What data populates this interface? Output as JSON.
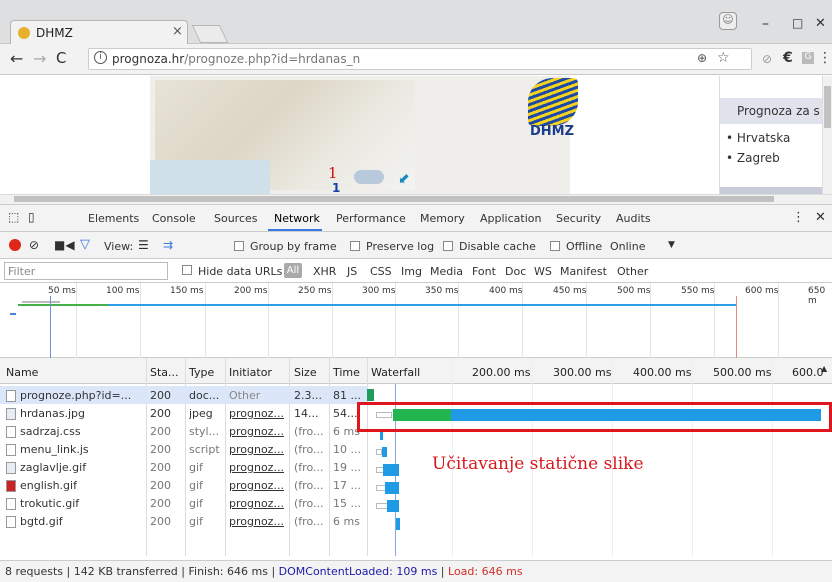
{
  "browser": {
    "tab_title": "DHMZ",
    "tab_close": "×",
    "url_host": "prognoza.hr",
    "url_path": "/prognoze.php?id=hrdanas_n",
    "controls": {
      "minimize": "–",
      "maximize": "□",
      "close": "✕",
      "back": "←",
      "forward": "→",
      "reload": "C",
      "zoom": "⊕",
      "star": "☆",
      "menu": "⋮"
    }
  },
  "page": {
    "logo_text": "DHMZ",
    "map_number_red": "1",
    "map_number_blue": "1",
    "side_heading": "Prognoza za s",
    "side_links": [
      "Hrvatska",
      "Zagreb"
    ]
  },
  "devtools": {
    "tabs": [
      "Elements",
      "Console",
      "Sources",
      "Network",
      "Performance",
      "Memory",
      "Application",
      "Security",
      "Audits"
    ],
    "active_tab": "Network",
    "toolbar": {
      "view_label": "View:",
      "group_by_frame": "Group by frame",
      "preserve_log": "Preserve log",
      "disable_cache": "Disable cache",
      "offline": "Offline",
      "throttle": "Online"
    },
    "filter": {
      "placeholder": "Filter",
      "hide_data_urls": "Hide data URLs",
      "types": [
        "All",
        "XHR",
        "JS",
        "CSS",
        "Img",
        "Media",
        "Font",
        "Doc",
        "WS",
        "Manifest",
        "Other"
      ]
    },
    "overview_ticks": [
      "50 ms",
      "100 ms",
      "150 ms",
      "200 ms",
      "250 ms",
      "300 ms",
      "350 ms",
      "400 ms",
      "450 ms",
      "500 ms",
      "550 ms",
      "600 ms",
      "650 m"
    ],
    "columns": [
      "Name",
      "Sta...",
      "Type",
      "Initiator",
      "Size",
      "Time",
      "Waterfall"
    ],
    "waterfall_ticks": [
      "200.00 ms",
      "300.00 ms",
      "400.00 ms",
      "500.00 ms",
      "600.0"
    ],
    "requests": [
      {
        "name": "prognoze.php?id=...",
        "status": "200",
        "type": "doc...",
        "initiator": "Other",
        "size": "2.3...",
        "time": "81 ...",
        "icon": "doc-icon"
      },
      {
        "name": "hrdanas.jpg",
        "status": "200",
        "type": "jpeg",
        "initiator": "prognoz...",
        "size": "14...",
        "time": "54...",
        "icon": "image-icon"
      },
      {
        "name": "sadrzaj.css",
        "status": "200",
        "type": "styl...",
        "initiator": "prognoz...",
        "size": "(fro...",
        "time": "6 ms",
        "icon": "doc-icon"
      },
      {
        "name": "menu_link.js",
        "status": "200",
        "type": "script",
        "initiator": "prognoz...",
        "size": "(fro...",
        "time": "10 ...",
        "icon": "doc-icon"
      },
      {
        "name": "zaglavlje.gif",
        "status": "200",
        "type": "gif",
        "initiator": "prognoz...",
        "size": "(fro...",
        "time": "19 ...",
        "icon": "image-icon"
      },
      {
        "name": "english.gif",
        "status": "200",
        "type": "gif",
        "initiator": "prognoz...",
        "size": "(fro...",
        "time": "17 ...",
        "icon": "flag-icon"
      },
      {
        "name": "trokutic.gif",
        "status": "200",
        "type": "gif",
        "initiator": "prognoz...",
        "size": "(fro...",
        "time": "15 ...",
        "icon": "triangle-icon"
      },
      {
        "name": "bgtd.gif",
        "status": "200",
        "type": "gif",
        "initiator": "prognoz...",
        "size": "(fro...",
        "time": "6 ms",
        "icon": "doc-icon"
      }
    ],
    "status": {
      "requests": "8 requests",
      "transferred": "142 KB transferred",
      "finish": "Finish: 646 ms",
      "dom_loaded": "DOMContentLoaded: 109 ms",
      "load": "Load: 646 ms"
    }
  },
  "annotation": {
    "text": "Učitavanje statične slike",
    "color": "#e0151d"
  }
}
